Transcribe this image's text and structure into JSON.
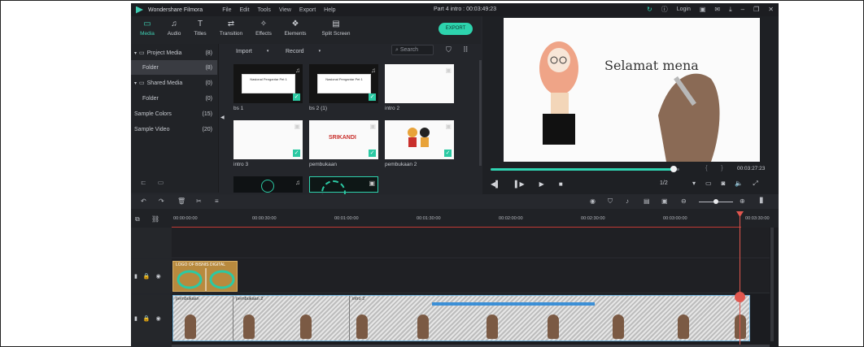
{
  "window": {
    "app_name": "Wondershare Filmora",
    "menu": [
      "File",
      "Edit",
      "Tools",
      "View",
      "Export",
      "Help"
    ],
    "project_title": "Part 4 intro : 00:03:49:23",
    "login_label": "Login"
  },
  "toolbar": {
    "tabs": [
      {
        "label": "Media",
        "icon": "folder-icon",
        "active": true
      },
      {
        "label": "Audio",
        "icon": "music-note-icon"
      },
      {
        "label": "Titles",
        "icon": "text-icon"
      },
      {
        "label": "Transition",
        "icon": "transition-icon"
      },
      {
        "label": "Effects",
        "icon": "effects-icon"
      },
      {
        "label": "Elements",
        "icon": "elements-icon"
      },
      {
        "label": "Split Screen",
        "icon": "split-screen-icon"
      }
    ],
    "export_label": "EXPORT",
    "accent_color": "#2dd3ad"
  },
  "library": {
    "items": [
      {
        "label": "Project Media",
        "count": "(8)"
      },
      {
        "label": "Folder",
        "count": "(8)"
      },
      {
        "label": "Shared Media",
        "count": "(0)"
      },
      {
        "label": "Folder",
        "count": "(0)"
      },
      {
        "label": "Sample Colors",
        "count": "(15)"
      },
      {
        "label": "Sample Video",
        "count": "(20)"
      }
    ]
  },
  "media": {
    "import_label": "Import",
    "record_label": "Record",
    "search_placeholder": "Search",
    "thumbs": [
      {
        "label": "bs 1",
        "caption": "Nasional Pengantar Pet 1"
      },
      {
        "label": "bs 2 (1)",
        "caption": "Nasional Pengantar Pet 1"
      },
      {
        "label": "intro 2"
      },
      {
        "label": "intro 3"
      },
      {
        "label": "pembukaan",
        "sign": "SRIKANDI"
      },
      {
        "label": "pembukaan 2"
      }
    ]
  },
  "preview": {
    "text": "Selamat mena",
    "timecode": "00:03:27:23",
    "quality": "1/2",
    "progress": 0.97
  },
  "timeline": {
    "ruler": [
      "00:00:00:00",
      "00:00:30:00",
      "00:01:00:00",
      "00:01:30:00",
      "00:02:00:00",
      "00:02:30:00",
      "00:03:00:00",
      "00:03:30:00"
    ],
    "clips": [
      {
        "label": "LOGO OF BISNIS DIGITAL"
      },
      {
        "label": "pembukaan"
      },
      {
        "label": "pembukaan 2"
      },
      {
        "label": "intro 2"
      }
    ]
  }
}
